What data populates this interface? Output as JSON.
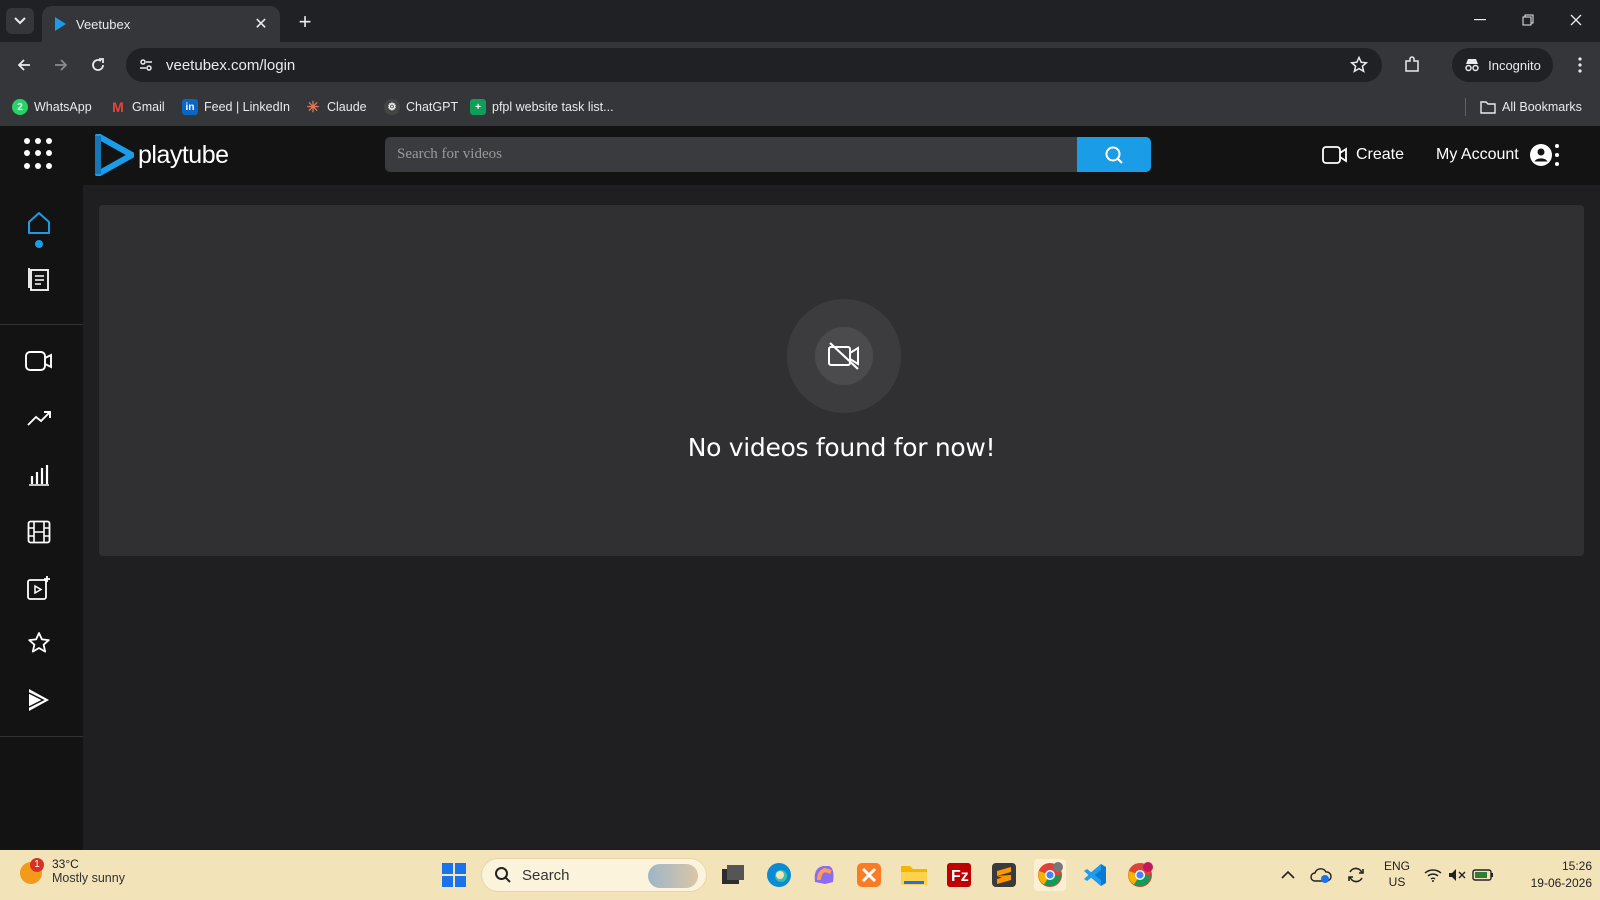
{
  "browser": {
    "tab_title": "Veetubex",
    "url": "veetubex.com/login",
    "incognito_label": "Incognito",
    "bookmarks": [
      {
        "label": "WhatsApp",
        "icon": "whatsapp-icon",
        "color": "#25d366"
      },
      {
        "label": "Gmail",
        "icon": "gmail-icon",
        "color": "#ea4335"
      },
      {
        "label": "Feed | LinkedIn",
        "icon": "linkedin-icon",
        "color": "#0a66c2"
      },
      {
        "label": "Claude",
        "icon": "claude-icon",
        "color": "#d97757"
      },
      {
        "label": "ChatGPT",
        "icon": "chatgpt-icon",
        "color": "#444444"
      },
      {
        "label": "pfpl website task list...",
        "icon": "sheets-icon",
        "color": "#0f9d58"
      }
    ],
    "all_bookmarks_label": "All Bookmarks"
  },
  "app": {
    "logo_text": "playtube",
    "search_placeholder": "Search for videos",
    "create_label": "Create",
    "account_label": "My Account",
    "accent_color": "#1b9ce6",
    "empty_message": "No videos found for now!"
  },
  "taskbar": {
    "weather_temp": "33°C",
    "weather_desc": "Mostly sunny",
    "weather_badge": "1",
    "search_label": "Search",
    "lang_top": "ENG",
    "lang_bottom": "US",
    "time": "15:26",
    "date": "19-06-2026"
  }
}
